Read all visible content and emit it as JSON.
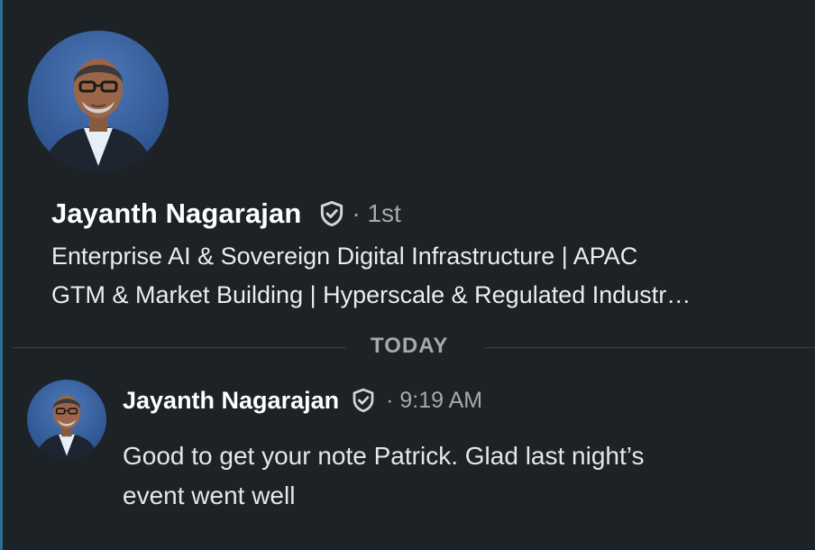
{
  "profile": {
    "name": "Jayanth Nagarajan",
    "degree": "· 1st",
    "headline_line1": "Enterprise AI & Sovereign Digital Infrastructure | APAC",
    "headline_line2": "GTM & Market Building | Hyperscale & Regulated Industr…",
    "avatar_icon": "profile-photo",
    "verified_icon": "verified-shield-icon"
  },
  "divider": {
    "label": "TODAY"
  },
  "message": {
    "sender": "Jayanth Nagarajan",
    "time": "· 9:19 AM",
    "text": "Good to get your note Patrick. Glad last night’s event went well"
  },
  "colors": {
    "background": "#1d2226",
    "accent": "#2d6f97",
    "muted_text": "#a8a8a8",
    "primary_text": "#ffffff"
  }
}
